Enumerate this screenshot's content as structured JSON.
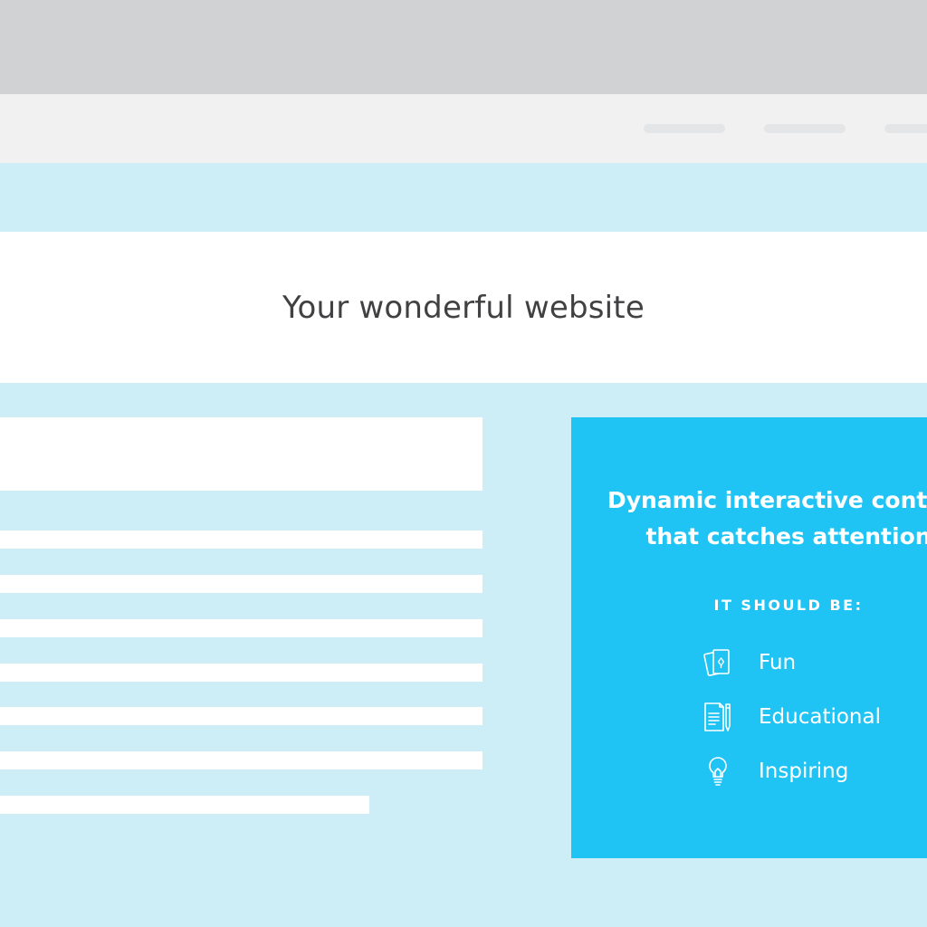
{
  "page": {
    "title": "Your wonderful website"
  },
  "promo": {
    "heading_line1": "Dynamic interactive content",
    "heading_line2": "that catches attention",
    "subheading": "IT SHOULD BE:",
    "features": [
      {
        "label": "Fun",
        "icon": "cards-icon"
      },
      {
        "label": "Educational",
        "icon": "document-pencil-icon"
      },
      {
        "label": "Inspiring",
        "icon": "lightbulb-icon"
      }
    ]
  },
  "colors": {
    "background": "#cdeef7",
    "browser_chrome": "#d1d2d4",
    "nav_bar": "#f1f1f2",
    "promo_panel": "#1fc4f4",
    "title_text": "#414042"
  }
}
